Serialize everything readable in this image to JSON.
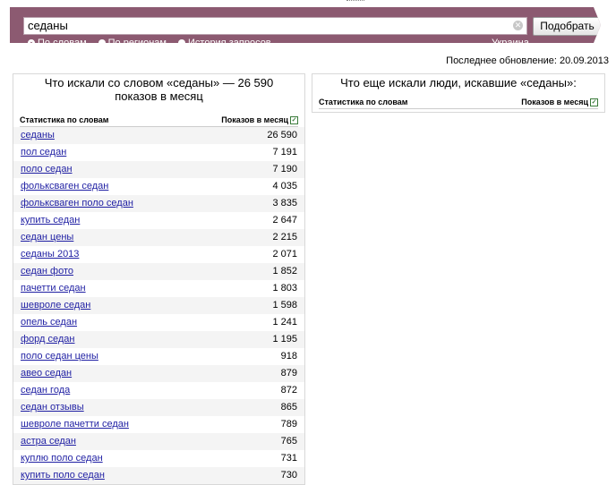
{
  "search": {
    "value": "седаны",
    "submit_label": "Подобрать",
    "modes": [
      {
        "label": "По словам",
        "selected": true
      },
      {
        "label": "По регионам",
        "selected": false
      },
      {
        "label": "История запросов",
        "selected": false
      }
    ],
    "region": "Украина"
  },
  "updated": "Последнее обновление: 20.09.2013",
  "left_panel": {
    "title": "Что искали со словом «седаны» — 26 590 показов в месяц",
    "col_keyword": "Статистика по словам",
    "col_count": "Показов в месяц",
    "rows": [
      {
        "kw": "седаны",
        "n": "26 590"
      },
      {
        "kw": "пол седан",
        "n": "7 191"
      },
      {
        "kw": "поло седан",
        "n": "7 190"
      },
      {
        "kw": "фольксваген седан",
        "n": "4 035"
      },
      {
        "kw": "фольксваген поло седан",
        "n": "3 835"
      },
      {
        "kw": "купить седан",
        "n": "2 647"
      },
      {
        "kw": "седан цены",
        "n": "2 215"
      },
      {
        "kw": "седаны 2013",
        "n": "2 071"
      },
      {
        "kw": "седан фото",
        "n": "1 852"
      },
      {
        "kw": "пачетти седан",
        "n": "1 803"
      },
      {
        "kw": "шевроле седан",
        "n": "1 598"
      },
      {
        "kw": "опель седан",
        "n": "1 241"
      },
      {
        "kw": "форд седан",
        "n": "1 195"
      },
      {
        "kw": "поло седан цены",
        "n": "918"
      },
      {
        "kw": "авео седан",
        "n": "879"
      },
      {
        "kw": "седан года",
        "n": "872"
      },
      {
        "kw": "седан отзывы",
        "n": "865"
      },
      {
        "kw": "шевроле пачетти седан",
        "n": "789"
      },
      {
        "kw": "астра седан",
        "n": "765"
      },
      {
        "kw": "куплю поло седан",
        "n": "731"
      },
      {
        "kw": "купить поло седан",
        "n": "730"
      }
    ]
  },
  "right_panel": {
    "title": "Что еще искали люди, искавшие «седаны»:",
    "col_keyword": "Статистика по словам",
    "col_count": "Показов в месяц"
  }
}
